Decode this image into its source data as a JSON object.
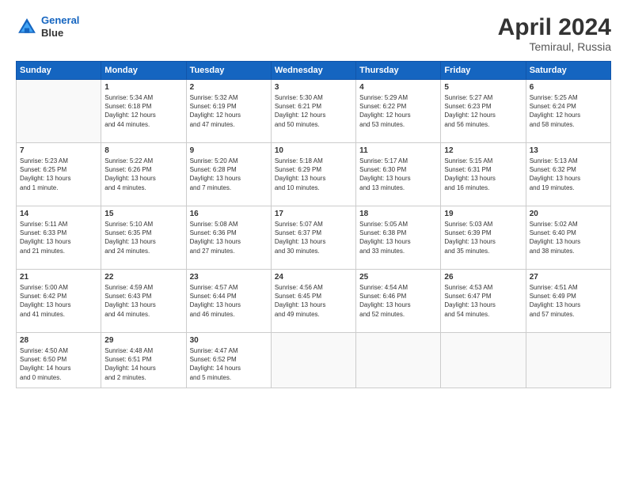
{
  "header": {
    "logo_line1": "General",
    "logo_line2": "Blue",
    "title": "April 2024",
    "location": "Temiraul, Russia"
  },
  "days_of_week": [
    "Sunday",
    "Monday",
    "Tuesday",
    "Wednesday",
    "Thursday",
    "Friday",
    "Saturday"
  ],
  "weeks": [
    [
      {
        "num": "",
        "info": ""
      },
      {
        "num": "1",
        "info": "Sunrise: 5:34 AM\nSunset: 6:18 PM\nDaylight: 12 hours\nand 44 minutes."
      },
      {
        "num": "2",
        "info": "Sunrise: 5:32 AM\nSunset: 6:19 PM\nDaylight: 12 hours\nand 47 minutes."
      },
      {
        "num": "3",
        "info": "Sunrise: 5:30 AM\nSunset: 6:21 PM\nDaylight: 12 hours\nand 50 minutes."
      },
      {
        "num": "4",
        "info": "Sunrise: 5:29 AM\nSunset: 6:22 PM\nDaylight: 12 hours\nand 53 minutes."
      },
      {
        "num": "5",
        "info": "Sunrise: 5:27 AM\nSunset: 6:23 PM\nDaylight: 12 hours\nand 56 minutes."
      },
      {
        "num": "6",
        "info": "Sunrise: 5:25 AM\nSunset: 6:24 PM\nDaylight: 12 hours\nand 58 minutes."
      }
    ],
    [
      {
        "num": "7",
        "info": "Sunrise: 5:23 AM\nSunset: 6:25 PM\nDaylight: 13 hours\nand 1 minute."
      },
      {
        "num": "8",
        "info": "Sunrise: 5:22 AM\nSunset: 6:26 PM\nDaylight: 13 hours\nand 4 minutes."
      },
      {
        "num": "9",
        "info": "Sunrise: 5:20 AM\nSunset: 6:28 PM\nDaylight: 13 hours\nand 7 minutes."
      },
      {
        "num": "10",
        "info": "Sunrise: 5:18 AM\nSunset: 6:29 PM\nDaylight: 13 hours\nand 10 minutes."
      },
      {
        "num": "11",
        "info": "Sunrise: 5:17 AM\nSunset: 6:30 PM\nDaylight: 13 hours\nand 13 minutes."
      },
      {
        "num": "12",
        "info": "Sunrise: 5:15 AM\nSunset: 6:31 PM\nDaylight: 13 hours\nand 16 minutes."
      },
      {
        "num": "13",
        "info": "Sunrise: 5:13 AM\nSunset: 6:32 PM\nDaylight: 13 hours\nand 19 minutes."
      }
    ],
    [
      {
        "num": "14",
        "info": "Sunrise: 5:11 AM\nSunset: 6:33 PM\nDaylight: 13 hours\nand 21 minutes."
      },
      {
        "num": "15",
        "info": "Sunrise: 5:10 AM\nSunset: 6:35 PM\nDaylight: 13 hours\nand 24 minutes."
      },
      {
        "num": "16",
        "info": "Sunrise: 5:08 AM\nSunset: 6:36 PM\nDaylight: 13 hours\nand 27 minutes."
      },
      {
        "num": "17",
        "info": "Sunrise: 5:07 AM\nSunset: 6:37 PM\nDaylight: 13 hours\nand 30 minutes."
      },
      {
        "num": "18",
        "info": "Sunrise: 5:05 AM\nSunset: 6:38 PM\nDaylight: 13 hours\nand 33 minutes."
      },
      {
        "num": "19",
        "info": "Sunrise: 5:03 AM\nSunset: 6:39 PM\nDaylight: 13 hours\nand 35 minutes."
      },
      {
        "num": "20",
        "info": "Sunrise: 5:02 AM\nSunset: 6:40 PM\nDaylight: 13 hours\nand 38 minutes."
      }
    ],
    [
      {
        "num": "21",
        "info": "Sunrise: 5:00 AM\nSunset: 6:42 PM\nDaylight: 13 hours\nand 41 minutes."
      },
      {
        "num": "22",
        "info": "Sunrise: 4:59 AM\nSunset: 6:43 PM\nDaylight: 13 hours\nand 44 minutes."
      },
      {
        "num": "23",
        "info": "Sunrise: 4:57 AM\nSunset: 6:44 PM\nDaylight: 13 hours\nand 46 minutes."
      },
      {
        "num": "24",
        "info": "Sunrise: 4:56 AM\nSunset: 6:45 PM\nDaylight: 13 hours\nand 49 minutes."
      },
      {
        "num": "25",
        "info": "Sunrise: 4:54 AM\nSunset: 6:46 PM\nDaylight: 13 hours\nand 52 minutes."
      },
      {
        "num": "26",
        "info": "Sunrise: 4:53 AM\nSunset: 6:47 PM\nDaylight: 13 hours\nand 54 minutes."
      },
      {
        "num": "27",
        "info": "Sunrise: 4:51 AM\nSunset: 6:49 PM\nDaylight: 13 hours\nand 57 minutes."
      }
    ],
    [
      {
        "num": "28",
        "info": "Sunrise: 4:50 AM\nSunset: 6:50 PM\nDaylight: 14 hours\nand 0 minutes."
      },
      {
        "num": "29",
        "info": "Sunrise: 4:48 AM\nSunset: 6:51 PM\nDaylight: 14 hours\nand 2 minutes."
      },
      {
        "num": "30",
        "info": "Sunrise: 4:47 AM\nSunset: 6:52 PM\nDaylight: 14 hours\nand 5 minutes."
      },
      {
        "num": "",
        "info": ""
      },
      {
        "num": "",
        "info": ""
      },
      {
        "num": "",
        "info": ""
      },
      {
        "num": "",
        "info": ""
      }
    ]
  ]
}
